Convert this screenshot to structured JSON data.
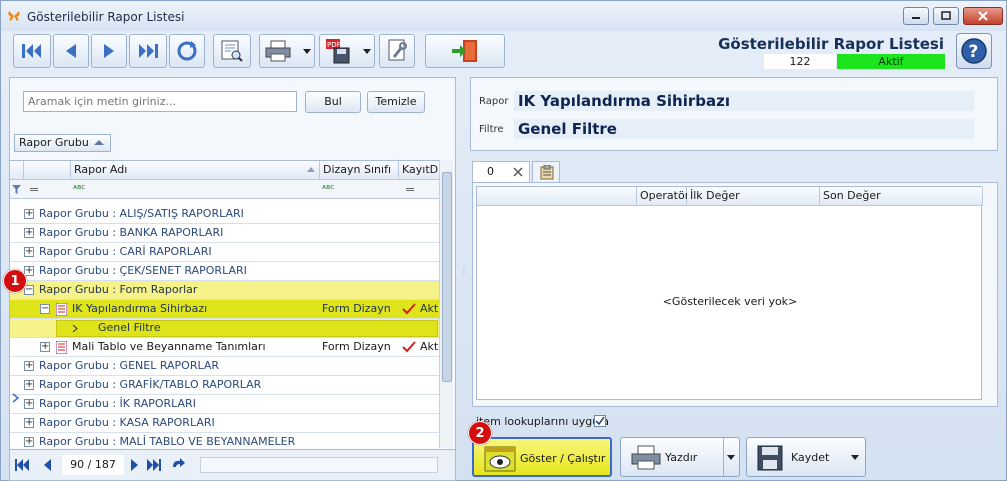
{
  "window": {
    "title": "Gösterilebilir Rapor Listesi"
  },
  "header": {
    "title": "Gösterilebilir Rapor Listesi",
    "count": "122",
    "status": "Aktif",
    "status_color": "#1de51d"
  },
  "toolbar": {
    "icons": [
      "first-icon",
      "prev-icon",
      "next-icon",
      "last-icon",
      "refresh-icon",
      "preview-icon",
      "print-icon",
      "pdf-save-icon",
      "settings-icon",
      "exit-icon",
      "help-icon"
    ]
  },
  "search": {
    "placeholder": "Aramak için metin giriniz...",
    "find_label": "Bul",
    "clear_label": "Temizle"
  },
  "group_panel": {
    "label": "Rapor Grubu"
  },
  "grid": {
    "columns": [
      "Rapor Adı",
      "Dizayn Sınıfı",
      "KayıtDı"
    ],
    "groups": [
      "Rapor Grubu : ALIŞ/SATIŞ RAPORLARI",
      "Rapor Grubu : BANKA RAPORLARI",
      "Rapor Grubu : CARİ RAPORLARI",
      "Rapor Grubu : ÇEK/SENET RAPORLARI",
      "Rapor Grubu : Form Raporlar"
    ],
    "selected_row": {
      "name": "IK Yapılandırma Sihirbazı",
      "design": "Form Dizayn",
      "active": "Akt"
    },
    "sub_row": "Genel Filtre",
    "row2": {
      "name": "Mali Tablo ve Beyanname Tanımları",
      "design": "Form Dizayn",
      "active": "Akt"
    },
    "groups_after": [
      "Rapor Grubu : GENEL RAPORLAR",
      "Rapor Grubu : GRAFİK/TABLO RAPORLAR",
      "Rapor Grubu : İK RAPORLARI",
      "Rapor Grubu : KASA RAPORLARI",
      "Rapor Grubu : MALİ TABLO VE BEYANNAMELER"
    ]
  },
  "navigator": {
    "position": "90 / 187"
  },
  "report": {
    "report_label": "Rapor",
    "report_value": "IK Yapılandırma Sihirbazı",
    "filter_label": "Filtre",
    "filter_value": "Genel Filtre"
  },
  "tabs": [
    "0"
  ],
  "params_grid": {
    "columns": [
      "Operatör",
      "İlk Değer",
      "Son Değer"
    ],
    "empty": "<Gösterilecek veri yok>"
  },
  "lookup": {
    "label": "item lookuplarını uygula",
    "checked": true
  },
  "actions": {
    "show_label": "Göster / Çalıştır",
    "print_label": "Yazdır",
    "save_label": "Kaydet"
  },
  "badges": [
    "1",
    "2"
  ]
}
